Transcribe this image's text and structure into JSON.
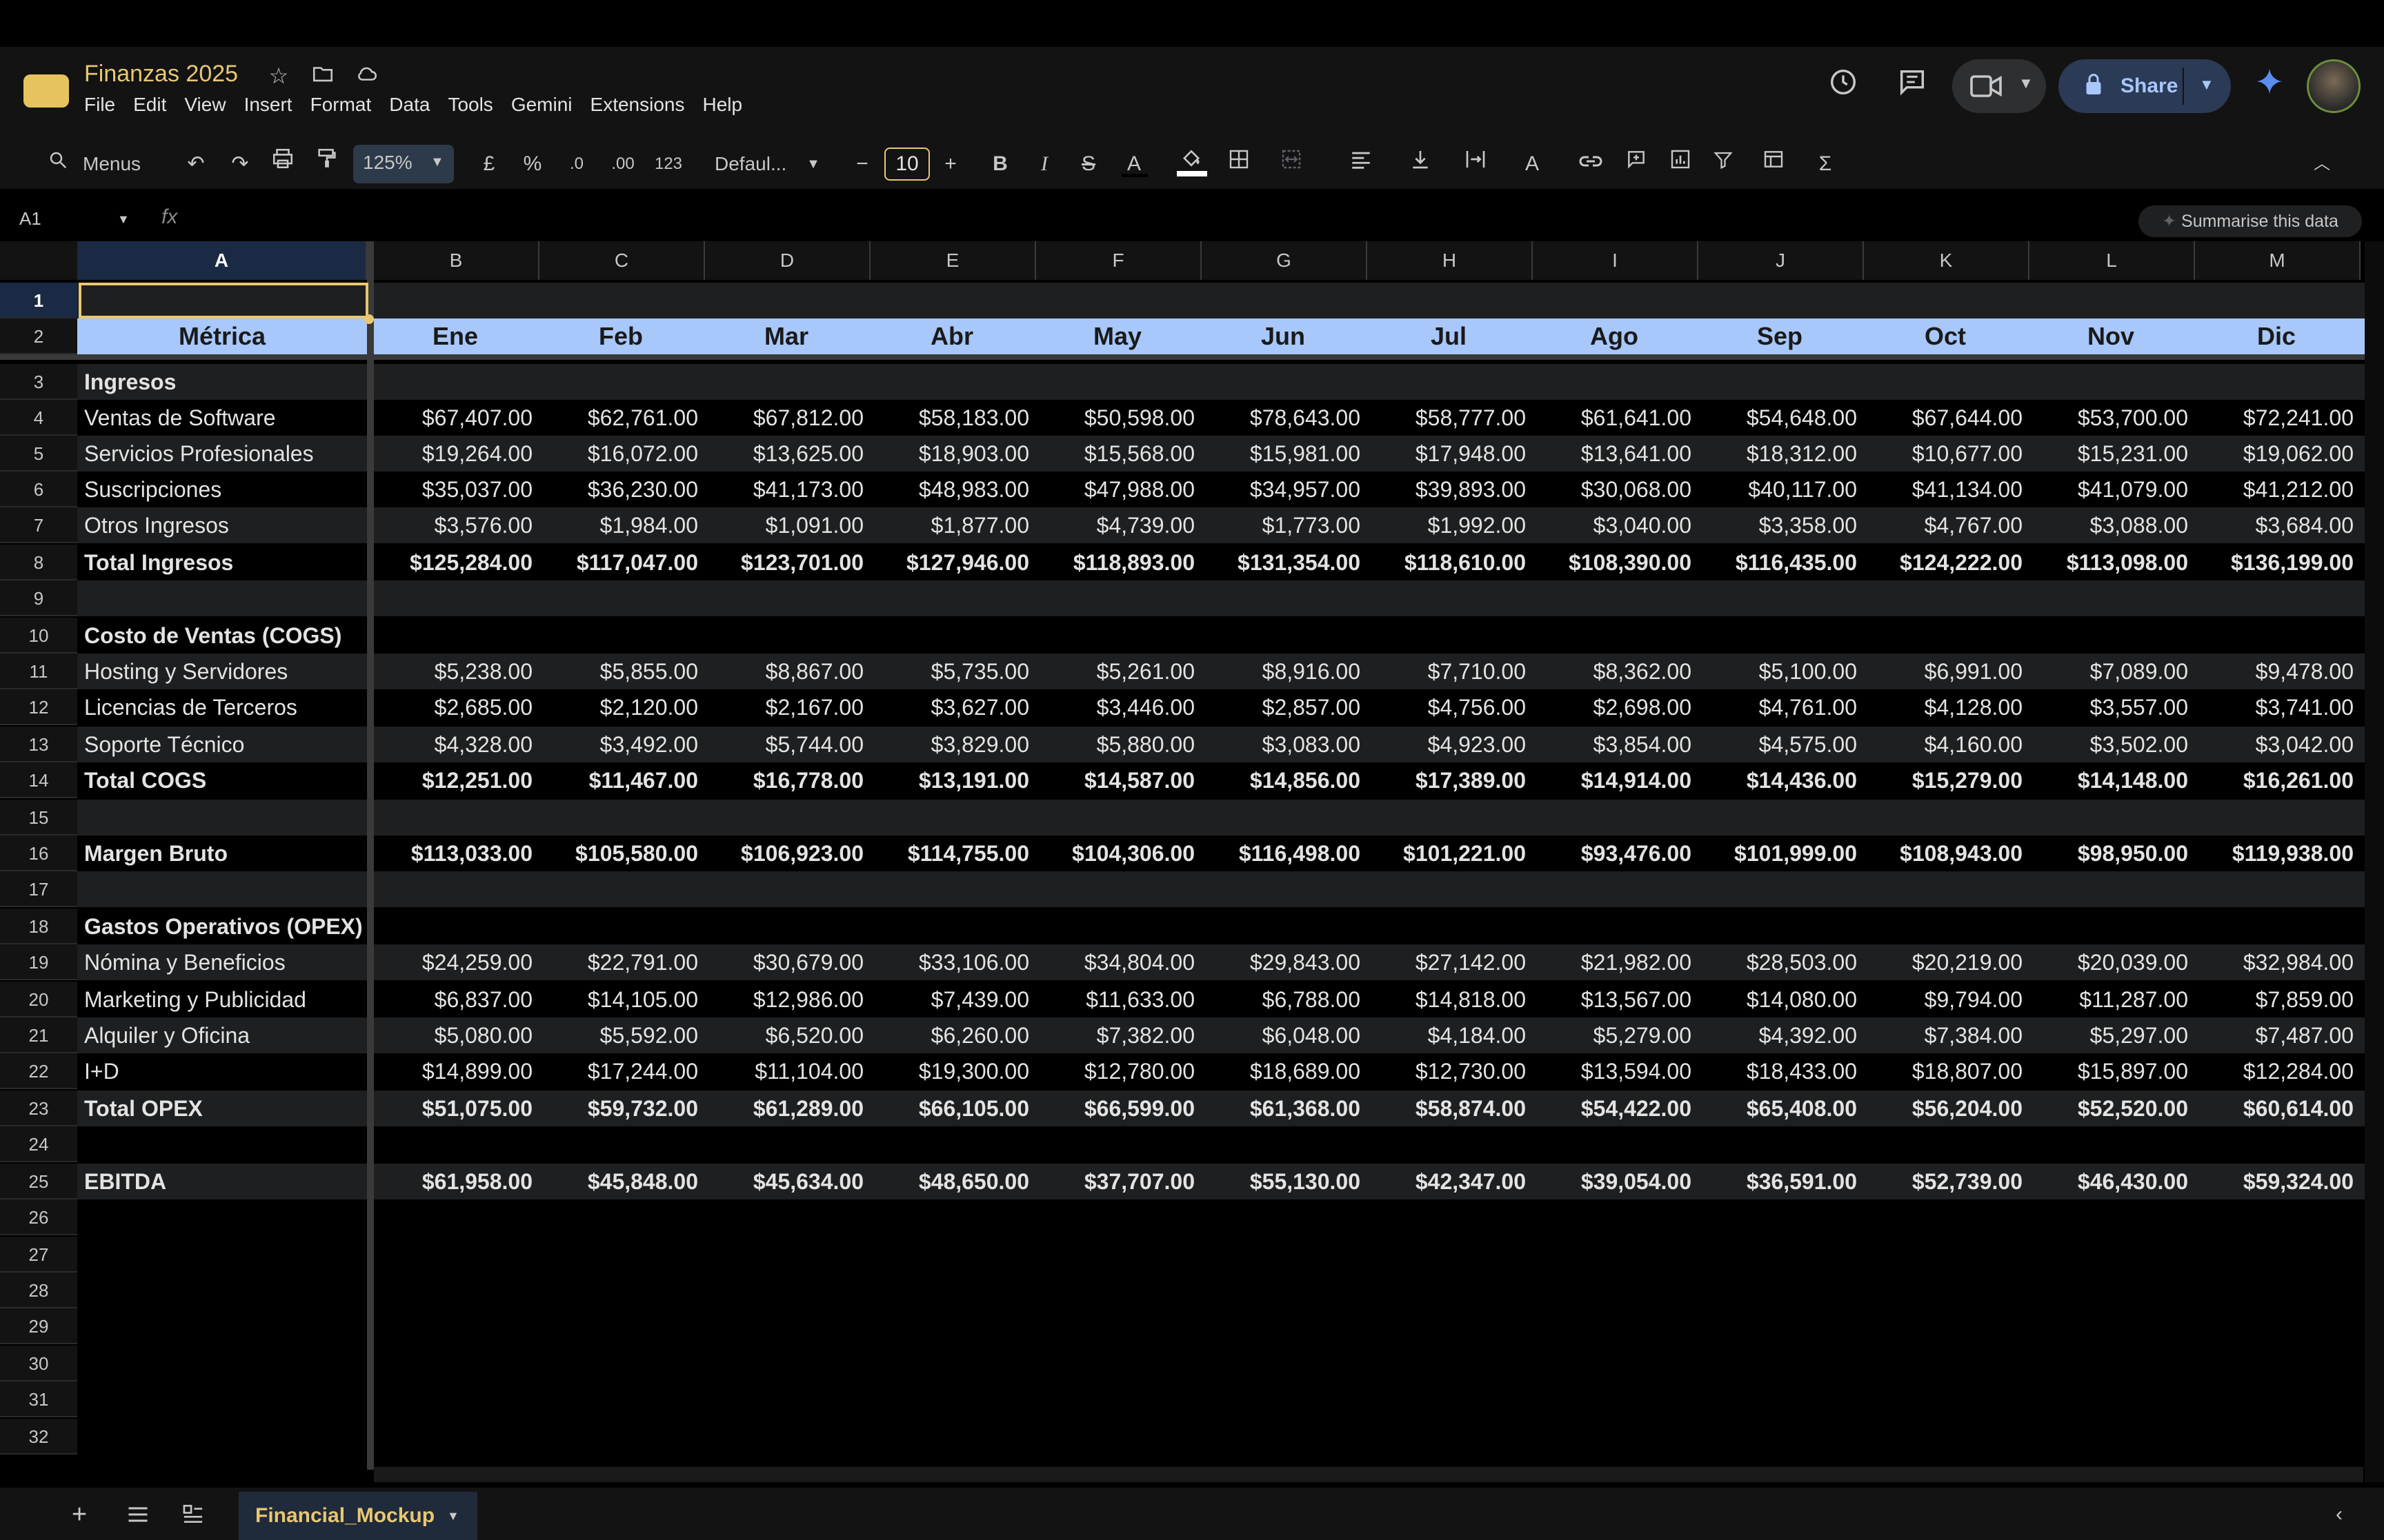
{
  "app": {
    "title": "Finanzas 2025",
    "menu": [
      "File",
      "Edit",
      "View",
      "Insert",
      "Format",
      "Data",
      "Tools",
      "Gemini",
      "Extensions",
      "Help"
    ],
    "share_label": "Share"
  },
  "toolbar": {
    "search_label": "Menus",
    "zoom": "125%",
    "currency": "£",
    "percent": "%",
    "dec_decrease": ".0",
    "dec_increase": ".00",
    "number_format": "123",
    "font": "Defaul...",
    "font_size": "10"
  },
  "formula_bar": {
    "name_box": "A1",
    "fx": "fx",
    "summarise": "Summarise this data"
  },
  "columns": [
    "A",
    "B",
    "C",
    "D",
    "E",
    "F",
    "G",
    "H",
    "I",
    "J",
    "K",
    "L",
    "M"
  ],
  "header_row": [
    "Métrica",
    "Ene",
    "Feb",
    "Mar",
    "Abr",
    "May",
    "Jun",
    "Jul",
    "Ago",
    "Sep",
    "Oct",
    "Nov",
    "Dic"
  ],
  "rows": [
    {
      "n": "1",
      "type": "empty",
      "label": "",
      "values": []
    },
    {
      "n": "2",
      "type": "header",
      "label": "",
      "values": []
    },
    {
      "n": "3",
      "type": "section",
      "label": "Ingresos",
      "values": []
    },
    {
      "n": "4",
      "type": "item",
      "label": "Ventas de Software",
      "values": [
        "$67,407.00",
        "$62,761.00",
        "$67,812.00",
        "$58,183.00",
        "$50,598.00",
        "$78,643.00",
        "$58,777.00",
        "$61,641.00",
        "$54,648.00",
        "$67,644.00",
        "$53,700.00",
        "$72,241.00"
      ]
    },
    {
      "n": "5",
      "type": "item",
      "label": "Servicios Profesionales",
      "values": [
        "$19,264.00",
        "$16,072.00",
        "$13,625.00",
        "$18,903.00",
        "$15,568.00",
        "$15,981.00",
        "$17,948.00",
        "$13,641.00",
        "$18,312.00",
        "$10,677.00",
        "$15,231.00",
        "$19,062.00"
      ]
    },
    {
      "n": "6",
      "type": "item",
      "label": "Suscripciones",
      "values": [
        "$35,037.00",
        "$36,230.00",
        "$41,173.00",
        "$48,983.00",
        "$47,988.00",
        "$34,957.00",
        "$39,893.00",
        "$30,068.00",
        "$40,117.00",
        "$41,134.00",
        "$41,079.00",
        "$41,212.00"
      ]
    },
    {
      "n": "7",
      "type": "item",
      "label": "Otros Ingresos",
      "values": [
        "$3,576.00",
        "$1,984.00",
        "$1,091.00",
        "$1,877.00",
        "$4,739.00",
        "$1,773.00",
        "$1,992.00",
        "$3,040.00",
        "$3,358.00",
        "$4,767.00",
        "$3,088.00",
        "$3,684.00"
      ]
    },
    {
      "n": "8",
      "type": "total",
      "label": "Total Ingresos",
      "values": [
        "$125,284.00",
        "$117,047.00",
        "$123,701.00",
        "$127,946.00",
        "$118,893.00",
        "$131,354.00",
        "$118,610.00",
        "$108,390.00",
        "$116,435.00",
        "$124,222.00",
        "$113,098.00",
        "$136,199.00"
      ]
    },
    {
      "n": "9",
      "type": "empty",
      "label": "",
      "values": []
    },
    {
      "n": "10",
      "type": "section",
      "label": "Costo de Ventas (COGS)",
      "values": []
    },
    {
      "n": "11",
      "type": "item",
      "label": "Hosting y Servidores",
      "values": [
        "$5,238.00",
        "$5,855.00",
        "$8,867.00",
        "$5,735.00",
        "$5,261.00",
        "$8,916.00",
        "$7,710.00",
        "$8,362.00",
        "$5,100.00",
        "$6,991.00",
        "$7,089.00",
        "$9,478.00"
      ]
    },
    {
      "n": "12",
      "type": "item",
      "label": "Licencias de Terceros",
      "values": [
        "$2,685.00",
        "$2,120.00",
        "$2,167.00",
        "$3,627.00",
        "$3,446.00",
        "$2,857.00",
        "$4,756.00",
        "$2,698.00",
        "$4,761.00",
        "$4,128.00",
        "$3,557.00",
        "$3,741.00"
      ]
    },
    {
      "n": "13",
      "type": "item",
      "label": "Soporte Técnico",
      "values": [
        "$4,328.00",
        "$3,492.00",
        "$5,744.00",
        "$3,829.00",
        "$5,880.00",
        "$3,083.00",
        "$4,923.00",
        "$3,854.00",
        "$4,575.00",
        "$4,160.00",
        "$3,502.00",
        "$3,042.00"
      ]
    },
    {
      "n": "14",
      "type": "total",
      "label": "Total COGS",
      "values": [
        "$12,251.00",
        "$11,467.00",
        "$16,778.00",
        "$13,191.00",
        "$14,587.00",
        "$14,856.00",
        "$17,389.00",
        "$14,914.00",
        "$14,436.00",
        "$15,279.00",
        "$14,148.00",
        "$16,261.00"
      ]
    },
    {
      "n": "15",
      "type": "empty",
      "label": "",
      "values": []
    },
    {
      "n": "16",
      "type": "total",
      "label": "Margen Bruto",
      "values": [
        "$113,033.00",
        "$105,580.00",
        "$106,923.00",
        "$114,755.00",
        "$104,306.00",
        "$116,498.00",
        "$101,221.00",
        "$93,476.00",
        "$101,999.00",
        "$108,943.00",
        "$98,950.00",
        "$119,938.00"
      ]
    },
    {
      "n": "17",
      "type": "empty",
      "label": "",
      "values": []
    },
    {
      "n": "18",
      "type": "section",
      "label": "Gastos Operativos (OPEX)",
      "values": []
    },
    {
      "n": "19",
      "type": "item",
      "label": "Nómina y Beneficios",
      "values": [
        "$24,259.00",
        "$22,791.00",
        "$30,679.00",
        "$33,106.00",
        "$34,804.00",
        "$29,843.00",
        "$27,142.00",
        "$21,982.00",
        "$28,503.00",
        "$20,219.00",
        "$20,039.00",
        "$32,984.00"
      ]
    },
    {
      "n": "20",
      "type": "item",
      "label": "Marketing y Publicidad",
      "values": [
        "$6,837.00",
        "$14,105.00",
        "$12,986.00",
        "$7,439.00",
        "$11,633.00",
        "$6,788.00",
        "$14,818.00",
        "$13,567.00",
        "$14,080.00",
        "$9,794.00",
        "$11,287.00",
        "$7,859.00"
      ]
    },
    {
      "n": "21",
      "type": "item",
      "label": "Alquiler y Oficina",
      "values": [
        "$5,080.00",
        "$5,592.00",
        "$6,520.00",
        "$6,260.00",
        "$7,382.00",
        "$6,048.00",
        "$4,184.00",
        "$5,279.00",
        "$4,392.00",
        "$7,384.00",
        "$5,297.00",
        "$7,487.00"
      ]
    },
    {
      "n": "22",
      "type": "item",
      "label": "I+D",
      "values": [
        "$14,899.00",
        "$17,244.00",
        "$11,104.00",
        "$19,300.00",
        "$12,780.00",
        "$18,689.00",
        "$12,730.00",
        "$13,594.00",
        "$18,433.00",
        "$18,807.00",
        "$15,897.00",
        "$12,284.00"
      ]
    },
    {
      "n": "23",
      "type": "total",
      "label": "Total OPEX",
      "values": [
        "$51,075.00",
        "$59,732.00",
        "$61,289.00",
        "$66,105.00",
        "$66,599.00",
        "$61,368.00",
        "$58,874.00",
        "$54,422.00",
        "$65,408.00",
        "$56,204.00",
        "$52,520.00",
        "$60,614.00"
      ]
    },
    {
      "n": "24",
      "type": "empty",
      "label": "",
      "values": []
    },
    {
      "n": "25",
      "type": "total",
      "label": "EBITDA",
      "values": [
        "$61,958.00",
        "$45,848.00",
        "$45,634.00",
        "$48,650.00",
        "$37,707.00",
        "$55,130.00",
        "$42,347.00",
        "$39,054.00",
        "$36,591.00",
        "$52,739.00",
        "$46,430.00",
        "$59,324.00"
      ]
    },
    {
      "n": "26",
      "type": "blank",
      "label": "",
      "values": []
    },
    {
      "n": "27",
      "type": "blank",
      "label": "",
      "values": []
    },
    {
      "n": "28",
      "type": "blank",
      "label": "",
      "values": []
    },
    {
      "n": "29",
      "type": "blank",
      "label": "",
      "values": []
    },
    {
      "n": "30",
      "type": "blank",
      "label": "",
      "values": []
    },
    {
      "n": "31",
      "type": "blank",
      "label": "",
      "values": []
    },
    {
      "n": "32",
      "type": "blank",
      "label": "",
      "values": []
    }
  ],
  "sheet_tab": "Financial_Mockup",
  "colors": {
    "header_fill": "#a8c7fa",
    "band_dark": "#1e1f20",
    "band_light": "#000000",
    "accent": "#e8c770"
  }
}
